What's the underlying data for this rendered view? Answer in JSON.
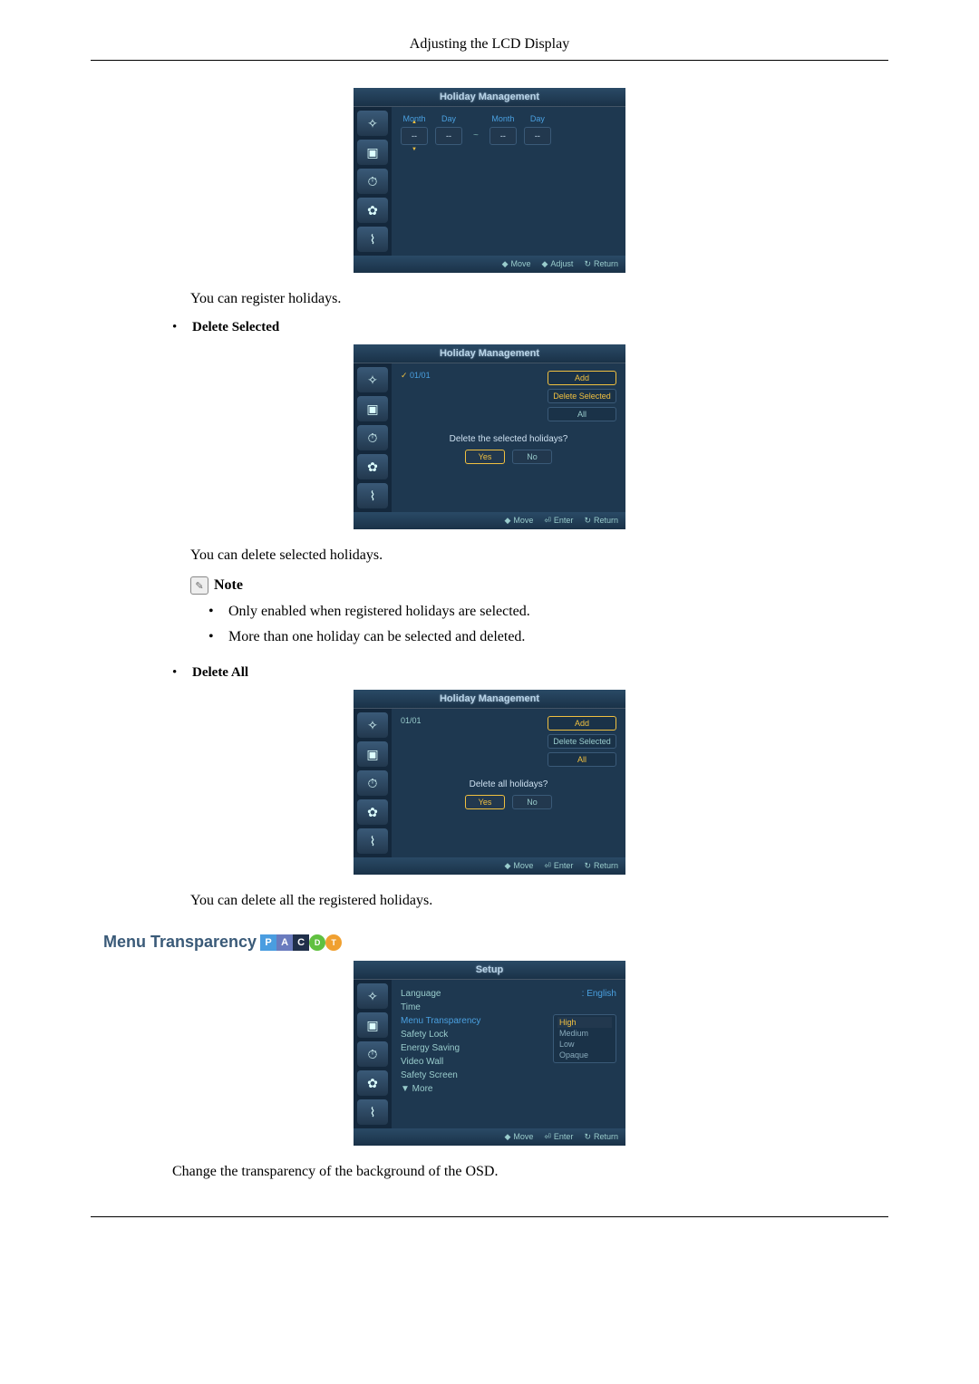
{
  "header": {
    "title": "Adjusting the LCD Display"
  },
  "osd_holiday_add": {
    "title": "Holiday Management",
    "cols": {
      "month": "Month",
      "day": "Day"
    },
    "start": {
      "month": "--",
      "day": "--"
    },
    "end": {
      "month": "--",
      "day": "--"
    },
    "tilde": "~",
    "footer": {
      "move": "Move",
      "adjust": "Adjust",
      "return": "Return"
    }
  },
  "text_register": "You can register holidays.",
  "bullet_delete_selected": "Delete Selected",
  "osd_delete_selected": {
    "title": "Holiday Management",
    "item": "01/01",
    "btn_add": "Add",
    "btn_del_sel": "Delete Selected",
    "btn_del_all": "All",
    "question": "Delete the selected holidays?",
    "yes": "Yes",
    "no": "No",
    "footer": {
      "move": "Move",
      "enter": "Enter",
      "return": "Return"
    }
  },
  "text_delete_selected": "You can delete selected holidays.",
  "note_label": "Note",
  "notes": [
    "Only enabled when registered holidays are selected.",
    "More than one holiday can be selected and deleted."
  ],
  "bullet_delete_all": "Delete All",
  "osd_delete_all": {
    "title": "Holiday Management",
    "item": "01/01",
    "btn_add": "Add",
    "btn_del_sel": "Delete Selected",
    "btn_del_all": "All",
    "question": "Delete all holidays?",
    "yes": "Yes",
    "no": "No",
    "footer": {
      "move": "Move",
      "enter": "Enter",
      "return": "Return"
    }
  },
  "text_delete_all": "You can delete all the registered holidays.",
  "section_menu_transparency": "Menu Transparency",
  "badges": {
    "p": "P",
    "a": "A",
    "c": "C",
    "d": "D",
    "t": "T"
  },
  "osd_setup": {
    "title": "Setup",
    "items": {
      "language": {
        "label": "Language",
        "value": ": English"
      },
      "time": {
        "label": "Time"
      },
      "menu_transparency": {
        "label": "Menu Transparency",
        "value": ":"
      },
      "safety_lock": {
        "label": "Safety Lock"
      },
      "energy_saving": {
        "label": "Energy Saving",
        "value": ":"
      },
      "video_wall": {
        "label": "Video Wall"
      },
      "safety_screen": {
        "label": "Safety Screen"
      },
      "more": {
        "label": "▼ More"
      }
    },
    "submenu": [
      "High",
      "Medium",
      "Low",
      "Opaque"
    ],
    "footer": {
      "move": "Move",
      "enter": "Enter",
      "return": "Return"
    }
  },
  "text_transparency": "Change the transparency of the background of the OSD.",
  "icons": {
    "side": [
      "✧",
      "▣",
      "⏱",
      "✿",
      "⌇"
    ]
  }
}
